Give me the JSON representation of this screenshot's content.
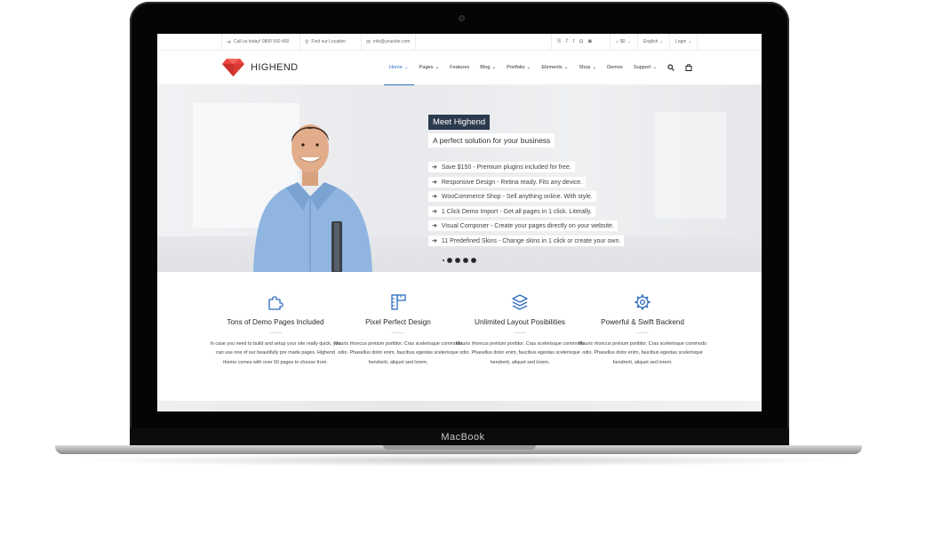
{
  "device": {
    "brand": "MacBook"
  },
  "topbar": {
    "phone": "Call us today! 0800 500 400",
    "location": "Find our Location",
    "email": "info@yoursite.com",
    "social_icons": [
      "skype-icon",
      "facebook-icon",
      "twitter-icon",
      "instagram-icon",
      "dribbble-icon"
    ],
    "currency": "$0",
    "language": "English",
    "login": "Login"
  },
  "header": {
    "logo_text": "HIGHEND",
    "brand_color": "#e8433c",
    "nav": [
      {
        "label": "Home",
        "dropdown": true,
        "active": true
      },
      {
        "label": "Pages",
        "dropdown": true
      },
      {
        "label": "Features",
        "dropdown": false
      },
      {
        "label": "Blog",
        "dropdown": true
      },
      {
        "label": "Portfolio",
        "dropdown": true
      },
      {
        "label": "Elements",
        "dropdown": true
      },
      {
        "label": "Shop",
        "dropdown": true
      },
      {
        "label": "Demos",
        "dropdown": false
      },
      {
        "label": "Support",
        "dropdown": true
      }
    ],
    "accent_color": "#2d6cc0"
  },
  "hero": {
    "title": "Meet Highend",
    "subtitle": "A perfect solution for your business",
    "bullets": [
      "Save $150 - Premium plugins included for free.",
      "Responsive Design - Retina ready. Fits any device.",
      "WooCommerce Shop - Sell anything online. With style.",
      "1 Click Demo Import - Get all pages in 1 click. Literally.",
      "Visual Composer - Create your pages directly on your website.",
      "11 Predefined Skins - Change skins in 1 click or create your own."
    ],
    "slider_dots": 5
  },
  "features": [
    {
      "icon": "puzzle-icon",
      "title": "Tons of Demo Pages Included",
      "desc": "In case you need to build and setup your site really quick, you can use one of our beautifully pre made pages. Highend theme comes with over 50 pages to choose from."
    },
    {
      "icon": "ruler-icon",
      "title": "Pixel Perfect Design",
      "desc": "Mauris rhoncus pretium porttitor. Cras scelerisque commodo odio. Phasellus dolor enim, faucibus egestas scelerisque hendrerit, aliquet sed lorem."
    },
    {
      "icon": "layers-icon",
      "title": "Unlimited Layout Posibilities",
      "desc": "Mauris rhoncus pretium porttitor. Cras scelerisque commodo odio. Phasellus dolor enim, faucibus egestas scelerisque hendrerit, aliquet sed lorem."
    },
    {
      "icon": "gear-icon",
      "title": "Powerful & Swift Backend",
      "desc": "Mauris rhoncus pretium porttitor. Cras scelerisque commodo odio. Phasellus dolor enim, faucibus egestas scelerisque hendrerit, aliquet sed lorem."
    }
  ]
}
